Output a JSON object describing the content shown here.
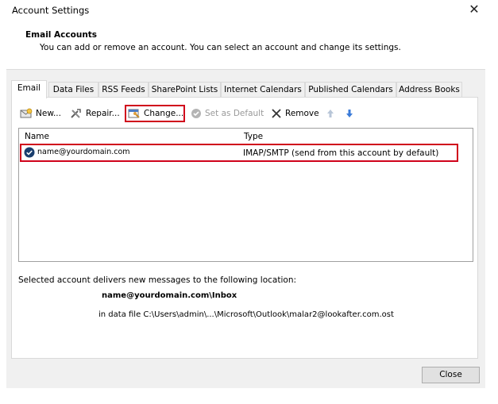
{
  "window": {
    "title": "Account Settings"
  },
  "header": {
    "title": "Email Accounts",
    "description": "You can add or remove an account. You can select an account and change its settings."
  },
  "tabs": [
    {
      "label": "Email"
    },
    {
      "label": "Data Files"
    },
    {
      "label": "RSS Feeds"
    },
    {
      "label": "SharePoint Lists"
    },
    {
      "label": "Internet Calendars"
    },
    {
      "label": "Published Calendars"
    },
    {
      "label": "Address Books"
    }
  ],
  "toolbar": {
    "new_label": "New...",
    "repair_label": "Repair...",
    "change_label": "Change...",
    "set_default_label": "Set as Default",
    "remove_label": "Remove"
  },
  "accounts_table": {
    "columns": [
      "Name",
      "Type"
    ],
    "rows": [
      {
        "name": "name@yourdomain.com",
        "type": "IMAP/SMTP (send from this account by default)"
      }
    ]
  },
  "delivery": {
    "label": "Selected account delivers new messages to the following location:",
    "folder": "name@yourdomain.com\\Inbox",
    "data_file": "in data file C:\\Users\\admin\\...\\Microsoft\\Outlook\\malar2@lookafter.com.ost"
  },
  "footer": {
    "close_label": "Close"
  },
  "colors": {
    "highlight_red": "#d0021b",
    "check_blue": "#1a3e6e",
    "arrow_blue": "#3b7bd8"
  }
}
